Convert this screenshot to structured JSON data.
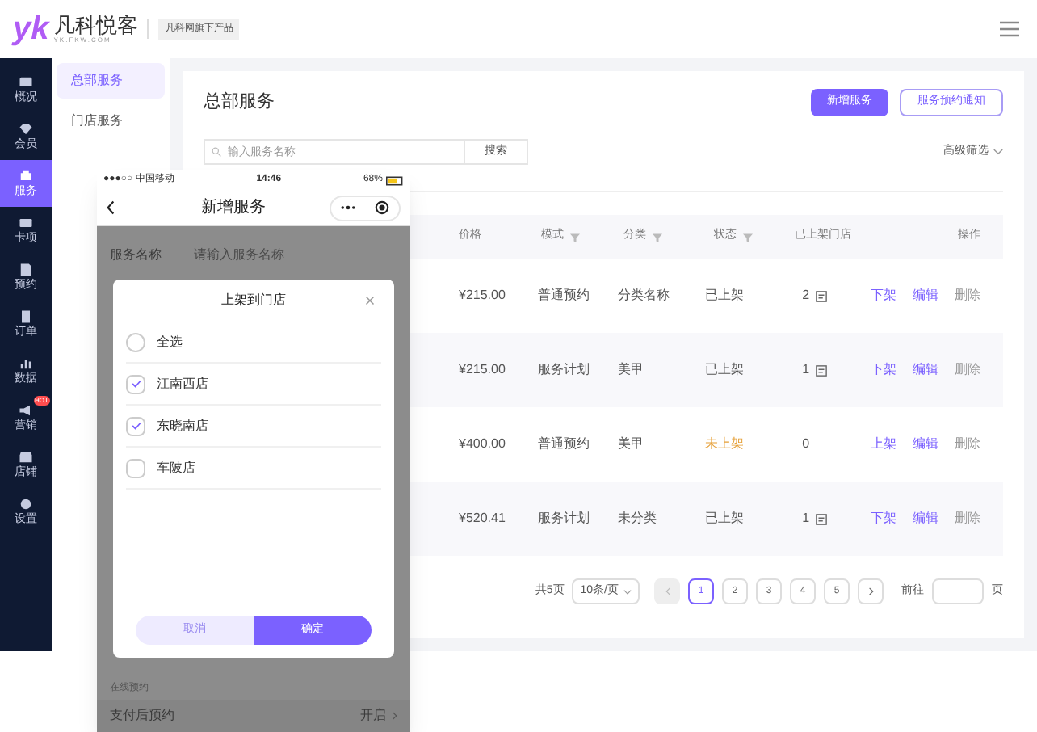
{
  "header": {
    "logo_mark": "yk",
    "brand": "凡科悦客",
    "domain": "YK.FKW.COM",
    "tag": "凡科网旗下产品"
  },
  "sidebar": {
    "items": [
      {
        "label": "概况",
        "selected": false
      },
      {
        "label": "会员",
        "selected": false
      },
      {
        "label": "服务",
        "selected": true
      },
      {
        "label": "卡项",
        "selected": false
      },
      {
        "label": "预约",
        "selected": false
      },
      {
        "label": "订单",
        "selected": false
      },
      {
        "label": "数据",
        "selected": false
      },
      {
        "label": "营销",
        "selected": false,
        "badge": "HOT"
      },
      {
        "label": "店铺",
        "selected": false
      },
      {
        "label": "设置",
        "selected": false
      }
    ]
  },
  "subnav": {
    "items": [
      {
        "label": "总部服务",
        "selected": true
      },
      {
        "label": "门店服务",
        "selected": false
      }
    ]
  },
  "page": {
    "title": "总部服务",
    "buttons": [
      {
        "label": "新增服务",
        "kind": "primary"
      },
      {
        "label": "服务预约通知",
        "kind": "outline"
      }
    ],
    "search": {
      "placeholder": "输入服务名称",
      "button": "搜索"
    },
    "filter": "高级筛选"
  },
  "table": {
    "columns": [
      {
        "label": "价格",
        "filter": false
      },
      {
        "label": "模式",
        "filter": true
      },
      {
        "label": "分类",
        "filter": true
      },
      {
        "label": "状态",
        "filter": true
      },
      {
        "label": "已上架门店",
        "filter": false
      },
      {
        "label": "操作",
        "filter": false
      }
    ],
    "rows": [
      {
        "price": "¥215.00",
        "mode": "普通预约",
        "category": "分类名称",
        "status": "已上架",
        "listed": true,
        "stores": "2",
        "actions": [
          "下架",
          "编辑",
          "删除"
        ]
      },
      {
        "price": "¥215.00",
        "mode": "服务计划",
        "category": "美甲",
        "status": "已上架",
        "listed": true,
        "stores": "1",
        "actions": [
          "下架",
          "编辑",
          "删除"
        ]
      },
      {
        "price": "¥400.00",
        "mode": "普通预约",
        "category": "美甲",
        "status": "未上架",
        "listed": false,
        "stores": "0",
        "actions": [
          "上架",
          "编辑",
          "删除"
        ]
      },
      {
        "price": "¥520.41",
        "mode": "服务计划",
        "category": "未分类",
        "status": "已上架",
        "listed": true,
        "stores": "1",
        "actions": [
          "下架",
          "编辑",
          "删除"
        ]
      }
    ]
  },
  "pagination": {
    "total": "共5页",
    "page_size": "10条/页",
    "pages": [
      {
        "label": "1",
        "selected": true
      },
      {
        "label": "2",
        "selected": false
      },
      {
        "label": "3",
        "selected": false
      },
      {
        "label": "4",
        "selected": false
      },
      {
        "label": "5",
        "selected": false
      }
    ],
    "goto": "前往",
    "goto_suffix": "页"
  },
  "phone": {
    "status_bar": {
      "carrier": "●●●○○ 中国移动",
      "time": "14:46",
      "battery": "68%"
    },
    "title": "新增服务",
    "form": [
      {
        "label": "服务名称",
        "placeholder": "请输入服务名称"
      }
    ],
    "section": "在线预约",
    "setting": {
      "label": "支付后预约",
      "value": "开启"
    },
    "dialog": {
      "title": "上架到门店",
      "options": [
        {
          "label": "全选",
          "kind": "radio",
          "checked": false
        },
        {
          "label": "江南西店",
          "kind": "checkbox",
          "checked": true
        },
        {
          "label": "东晓南店",
          "kind": "checkbox",
          "checked": true
        },
        {
          "label": "车陂店",
          "kind": "checkbox",
          "checked": false
        }
      ],
      "cancel": "取消",
      "confirm": "确定"
    }
  }
}
